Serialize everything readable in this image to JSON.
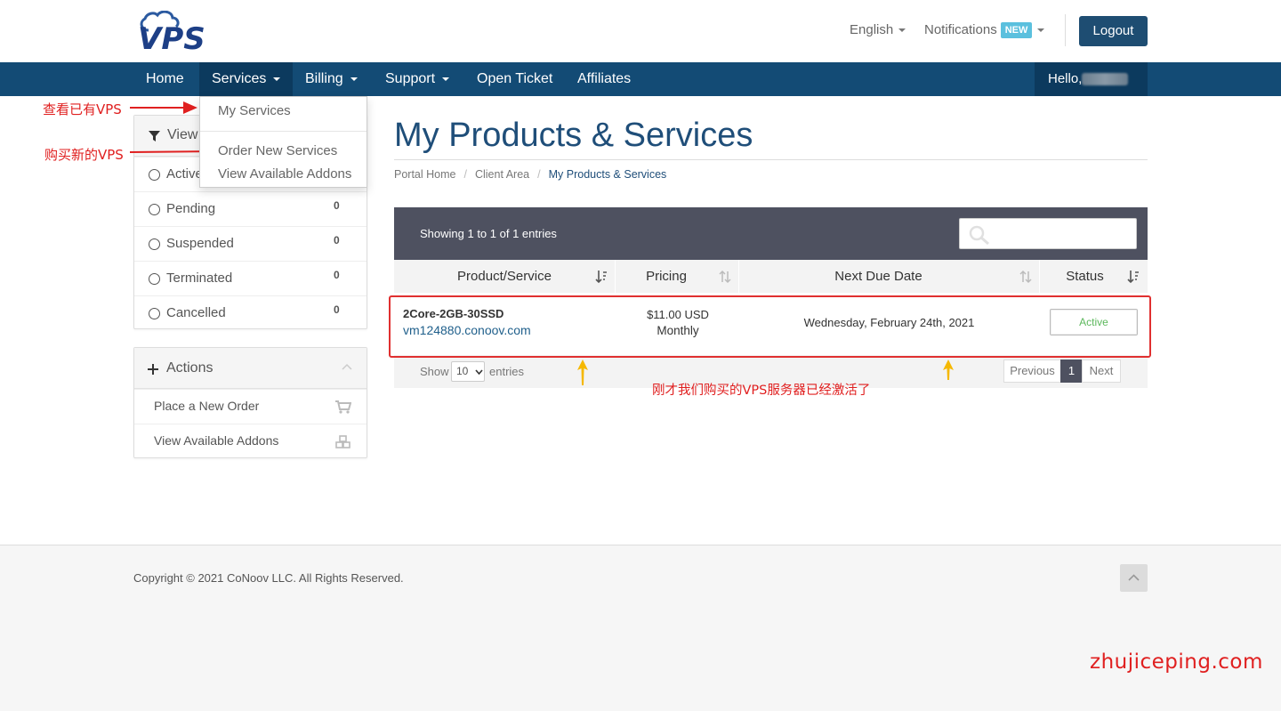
{
  "header": {
    "logo_text": "VPS",
    "language": "English",
    "notifications": "Notifications",
    "notifications_badge": "NEW",
    "logout": "Logout"
  },
  "nav": {
    "home": "Home",
    "services": "Services",
    "billing": "Billing",
    "support": "Support",
    "open_ticket": "Open Ticket",
    "affiliates": "Affiliates",
    "hello": "Hello,"
  },
  "services_dropdown": {
    "items": [
      "My Services",
      "Order New Services",
      "View Available Addons"
    ]
  },
  "annotations": {
    "view_existing": "查看已有VPS",
    "buy_new": "购买新的VPS",
    "activated_note": "刚才我们购买的VPS服务器已经激活了",
    "watermark": "zhujiceping.com"
  },
  "sidebar": {
    "view_title": "View",
    "filters": [
      {
        "label": "Active",
        "count": ""
      },
      {
        "label": "Pending",
        "count": "0"
      },
      {
        "label": "Suspended",
        "count": "0"
      },
      {
        "label": "Terminated",
        "count": "0"
      },
      {
        "label": "Cancelled",
        "count": "0"
      }
    ],
    "actions_title": "Actions",
    "actions": [
      "Place a New Order",
      "View Available Addons"
    ]
  },
  "main": {
    "title": "My Products & Services",
    "breadcrumb": [
      "Portal Home",
      "Client Area",
      "My Products & Services"
    ],
    "showing": "Showing 1 to 1 of 1 entries",
    "columns": [
      "Product/Service",
      "Pricing",
      "Next Due Date",
      "Status"
    ],
    "rows": [
      {
        "product": "2Core-2GB-30SSD",
        "domain": "vm124880.conoov.com",
        "price": "$11.00 USD",
        "cycle": "Monthly",
        "due": "Wednesday, February 24th, 2021",
        "status": "Active"
      }
    ],
    "show_label": "Show",
    "page_length": "10",
    "entries_label": "entries",
    "pagination": {
      "previous": "Previous",
      "current": "1",
      "next": "Next"
    }
  },
  "footer": {
    "copyright": "Copyright © 2021 CoNoov LLC. All Rights Reserved."
  },
  "colors": {
    "nav_bg": "#134b75",
    "title": "#1f4e79",
    "annotation_red": "#e02020",
    "status_green": "#5cb85c",
    "table_header_dark": "#4e5160",
    "arrow_yellow": "#f5b800"
  }
}
